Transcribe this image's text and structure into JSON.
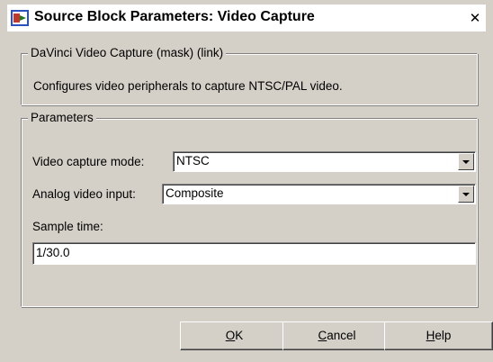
{
  "window": {
    "title": "Source Block Parameters: Video Capture",
    "close_glyph": "✕"
  },
  "description": {
    "group_label": "DaVinci Video Capture (mask) (link)",
    "text": "Configures video peripherals to capture NTSC/PAL video."
  },
  "parameters": {
    "group_label": "Parameters",
    "video_capture_mode": {
      "label": "Video capture mode:",
      "value": "NTSC"
    },
    "analog_video_input": {
      "label": "Analog video input:",
      "value": "Composite"
    },
    "sample_time": {
      "label": "Sample time:",
      "value": "1/30.0"
    }
  },
  "buttons": {
    "ok": {
      "mnemonic": "O",
      "rest": "K"
    },
    "cancel": {
      "mnemonic": "C",
      "rest": "ancel"
    },
    "help": {
      "mnemonic": "H",
      "rest": "elp"
    }
  },
  "icons": {
    "app": "simulink-block-icon",
    "close": "close-icon",
    "dropdown": "chevron-down-icon"
  },
  "colors": {
    "face": "#d4d0c8",
    "titlebar": "#ffffff",
    "field": "#ffffff"
  }
}
